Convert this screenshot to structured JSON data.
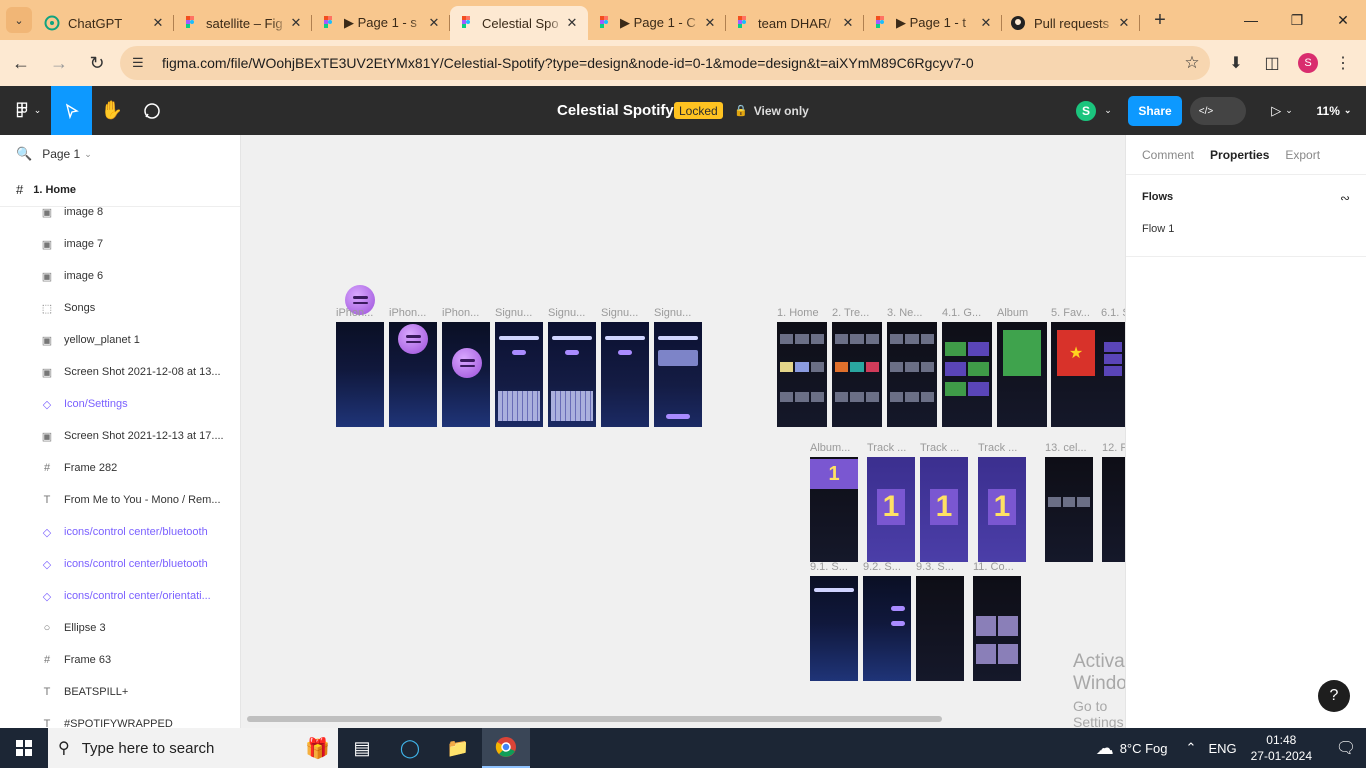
{
  "browser": {
    "tabs": [
      {
        "title": "ChatGPT",
        "icon": "chatgpt-icon",
        "active": false
      },
      {
        "title": "satellite – Fig",
        "icon": "figma-icon",
        "active": false
      },
      {
        "title": "▶ Page 1 - s",
        "icon": "figma-icon",
        "active": false
      },
      {
        "title": "Celestial Spo",
        "icon": "figma-icon",
        "active": true
      },
      {
        "title": "▶ Page 1 - C",
        "icon": "figma-icon",
        "active": false
      },
      {
        "title": "team DHAR/",
        "icon": "figma-icon",
        "active": false
      },
      {
        "title": "▶ Page 1 - t",
        "icon": "figma-icon",
        "active": false
      },
      {
        "title": "Pull requests",
        "icon": "github-icon",
        "active": false
      }
    ],
    "url": "figma.com/file/WOohjBExTE3UV2EtYMx81Y/Celestial-Spotify?type=design&node-id=0-1&mode=design&t=aiXYmM89C6Rgcyv7-0",
    "profile_initial": "S"
  },
  "figma": {
    "file_title": "Celestial Spotify",
    "locked_badge": "Locked",
    "view_only": "View only",
    "user_initial": "S",
    "share_label": "Share",
    "zoom": "11%"
  },
  "left_panel": {
    "page_name": "Page 1",
    "current_frame": "1. Home",
    "layers": [
      {
        "name": "image 8",
        "type": "image"
      },
      {
        "name": "image 7",
        "type": "image"
      },
      {
        "name": "image 6",
        "type": "image"
      },
      {
        "name": "Songs",
        "type": "section"
      },
      {
        "name": "yellow_planet 1",
        "type": "image"
      },
      {
        "name": "Screen Shot 2021-12-08 at 13...",
        "type": "image"
      },
      {
        "name": "Icon/Settings",
        "type": "component"
      },
      {
        "name": "Screen Shot 2021-12-13 at 17....",
        "type": "image"
      },
      {
        "name": "Frame 282",
        "type": "frame"
      },
      {
        "name": "From Me to You - Mono / Rem...",
        "type": "text"
      },
      {
        "name": "icons/control center/bluetooth",
        "type": "component"
      },
      {
        "name": "icons/control center/bluetooth",
        "type": "component"
      },
      {
        "name": "icons/control center/orientati...",
        "type": "component"
      },
      {
        "name": "Ellipse 3",
        "type": "ellipse"
      },
      {
        "name": "Frame 63",
        "type": "frame"
      },
      {
        "name": "BEATSPILL+",
        "type": "text"
      },
      {
        "name": "#SPOTIFYWRAPPED",
        "type": "text"
      }
    ]
  },
  "canvas": {
    "frame_labels": {
      "iphone1": "iPhon...",
      "iphone2": "iPhon...",
      "iphone3": "iPhon...",
      "signup1": "Signu...",
      "signup2": "Signu...",
      "signup3": "Signu...",
      "signup4": "Signu...",
      "home": "1. Home",
      "trending": "2. Tre...",
      "new": "3. Ne...",
      "genre": "4.1. G...",
      "album": "Album",
      "fav": "5. Fav...",
      "six": "6.1. S",
      "album2": "Album...",
      "track1": "Track ...",
      "track2": "Track ...",
      "track3": "Track ...",
      "celeb": "13. cel...",
      "twelve": "12. P",
      "s91": "9.1. S...",
      "s92": "9.2. S...",
      "s93": "9.3. S...",
      "co11": "11. Co..."
    },
    "big_number": "1",
    "watermark_title": "Activate Windows",
    "watermark_sub": "Go to Settings to activate Windows."
  },
  "right_panel": {
    "tabs": [
      "Comment",
      "Properties",
      "Export"
    ],
    "active_tab": "Properties",
    "flows_heading": "Flows",
    "flow_item": "Flow 1"
  },
  "taskbar": {
    "search_placeholder": "Type here to search",
    "weather": "8°C  Fog",
    "language": "ENG",
    "time": "01:48",
    "date": "27-01-2024"
  },
  "colors": {
    "chrome_tabstrip": "#f8c78e",
    "chrome_toolbar": "#fde9d2",
    "figma_toolbar": "#2c2c2c",
    "figma_blue": "#0d99ff",
    "locked_yellow": "#ffc321",
    "component_purple": "#7b61ff",
    "taskbar": "#1c2635"
  }
}
